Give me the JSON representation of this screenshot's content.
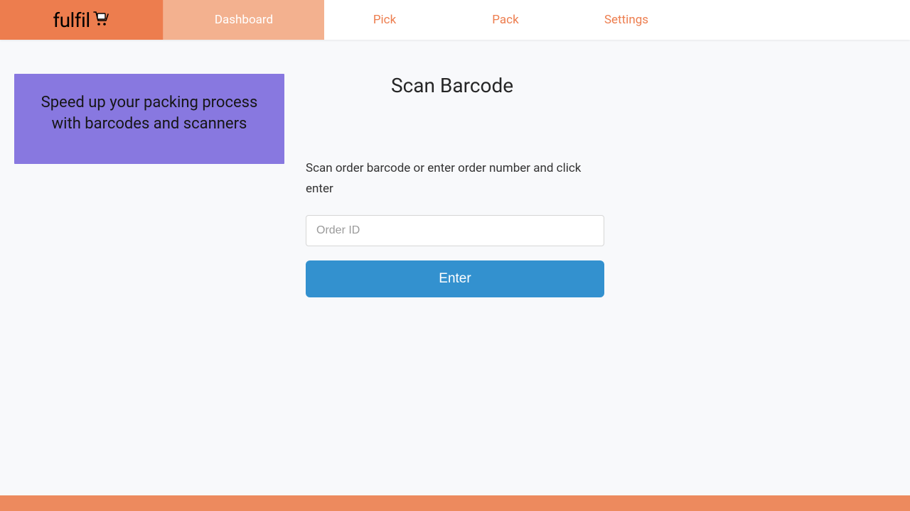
{
  "brand": {
    "name": "fulfil"
  },
  "nav": {
    "items": [
      {
        "label": "Dashboard",
        "active": true
      },
      {
        "label": "Pick",
        "active": false
      },
      {
        "label": "Pack",
        "active": false
      },
      {
        "label": "Settings",
        "active": false
      }
    ]
  },
  "promo": {
    "text": "Speed up your packing process with barcodes and scanners"
  },
  "scan": {
    "heading": "Scan Barcode",
    "instructions": "Scan order barcode or enter order number and click enter",
    "placeholder": "Order ID",
    "button_label": "Enter"
  },
  "footer": {
    "text": ""
  }
}
